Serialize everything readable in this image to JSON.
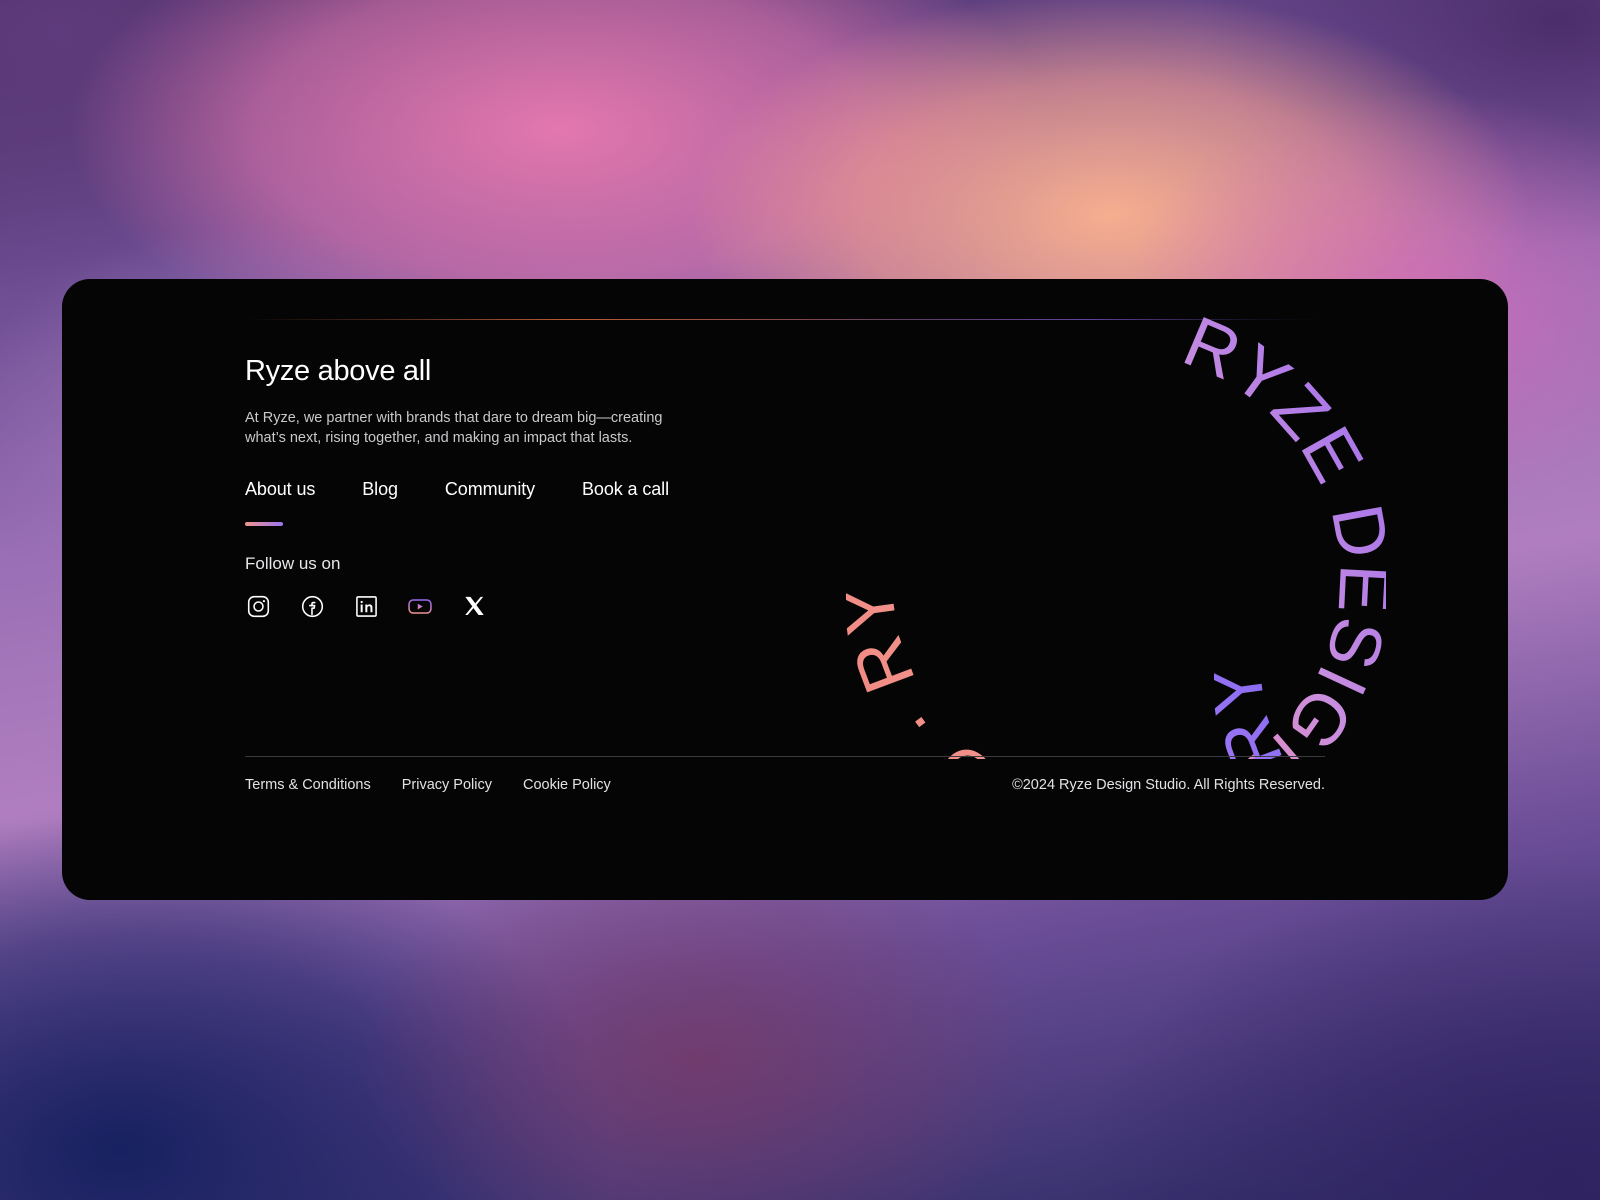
{
  "background": {
    "colors": {
      "violet": "#603c7e",
      "pink": "#ea7ab0",
      "peach": "#f8b08e",
      "magenta": "#d66cba",
      "navy": "#162060",
      "indigo": "#302262",
      "lilac": "#aa84c8"
    }
  },
  "card": {
    "background_color": "#050505",
    "accent_line_colors": [
      "#c4603a",
      "#6c4ab0"
    ],
    "corner_radius": 28
  },
  "footer": {
    "heading": "Ryze above all",
    "description": "At Ryze, we partner with brands that dare to dream big—creating what’s next, rising together, and making an impact that lasts.",
    "nav": [
      {
        "label": "About us",
        "active": true
      },
      {
        "label": "Blog",
        "active": false
      },
      {
        "label": "Community",
        "active": false
      },
      {
        "label": "Book a call",
        "active": false
      }
    ],
    "nav_underline": {
      "gradient_from": "#f2948f",
      "gradient_to": "#9a74f0"
    },
    "follow_label": "Follow us on",
    "social": [
      {
        "name": "instagram",
        "icon": "instagram-icon",
        "color": "#ffffff"
      },
      {
        "name": "facebook",
        "icon": "facebook-icon",
        "color": "#ffffff"
      },
      {
        "name": "linkedin",
        "icon": "linkedin-icon",
        "color": "#ffffff"
      },
      {
        "name": "youtube",
        "icon": "youtube-icon",
        "color": "gradient",
        "gradient_from": "#9a6cf0",
        "gradient_to": "#f2948f"
      },
      {
        "name": "x",
        "icon": "x-icon",
        "color": "#ffffff"
      }
    ],
    "circular_text": {
      "text": "RYZE DESIGN STUDIO · ",
      "repeats": 2,
      "gradient_stops": [
        "#f2948f",
        "#ee8fb8",
        "#c98ede",
        "#9a6cf0",
        "#4b3ee8",
        "#1a1a7a"
      ]
    },
    "legal_links": [
      {
        "label": "Terms & Conditions"
      },
      {
        "label": "Privacy Policy"
      },
      {
        "label": "Cookie Policy"
      }
    ],
    "copyright": "©2024 Ryze Design Studio. All Rights Reserved."
  }
}
